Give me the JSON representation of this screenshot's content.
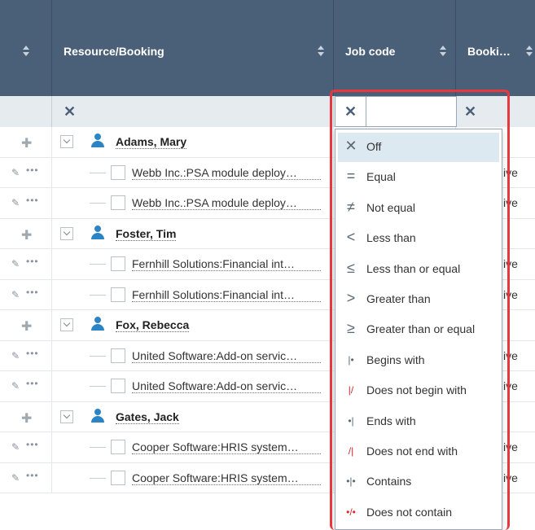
{
  "header": {
    "col_resource": "Resource/Booking",
    "col_jobcode": "Job code",
    "col_booking": "Booki…"
  },
  "filter_row": {
    "clear_symbol": "✕",
    "jobcode_value": ""
  },
  "rows": [
    {
      "type": "group",
      "name": "Adams, Mary"
    },
    {
      "type": "item",
      "name": "Webb Inc.:PSA module deploy…",
      "status": "ive"
    },
    {
      "type": "item",
      "name": "Webb Inc.:PSA module deploy…",
      "status": "ive"
    },
    {
      "type": "group",
      "name": "Foster, Tim"
    },
    {
      "type": "item",
      "name": "Fernhill Solutions:Financial int…",
      "status": "ive"
    },
    {
      "type": "item",
      "name": "Fernhill Solutions:Financial int…",
      "status": "ive"
    },
    {
      "type": "group",
      "name": "Fox, Rebecca"
    },
    {
      "type": "item",
      "name": "United Software:Add-on servic…",
      "status": "ive"
    },
    {
      "type": "item",
      "name": "United Software:Add-on servic…",
      "status": "ive"
    },
    {
      "type": "group",
      "name": "Gates, Jack"
    },
    {
      "type": "item",
      "name": "Cooper Software:HRIS system…",
      "status": "ive"
    },
    {
      "type": "item",
      "name": "Cooper Software:HRIS system…",
      "status": "ive"
    }
  ],
  "filter_menu": {
    "items": [
      {
        "icon": "✕",
        "label": "Off",
        "selected": true
      },
      {
        "icon": "=",
        "label": "Equal"
      },
      {
        "icon": "≠",
        "label": "Not equal"
      },
      {
        "icon": "<",
        "label": "Less than"
      },
      {
        "icon": "≤",
        "label": "Less than or equal"
      },
      {
        "icon": ">",
        "label": "Greater than"
      },
      {
        "icon": "≥",
        "label": "Greater than or equal"
      },
      {
        "icon": "|•",
        "label": "Begins with"
      },
      {
        "icon": "|/",
        "label": "Does not begin with"
      },
      {
        "icon": "•|",
        "label": "Ends with"
      },
      {
        "icon": "/|",
        "label": "Does not end with"
      },
      {
        "icon": "•|•",
        "label": "Contains"
      },
      {
        "icon": "•/•",
        "label": "Does not contain"
      }
    ]
  },
  "colors": {
    "header_bg": "#4a5f78",
    "highlight_border": "#e8383d",
    "person_icon": "#2b84c6",
    "selected_item_bg": "#dde9f0"
  }
}
